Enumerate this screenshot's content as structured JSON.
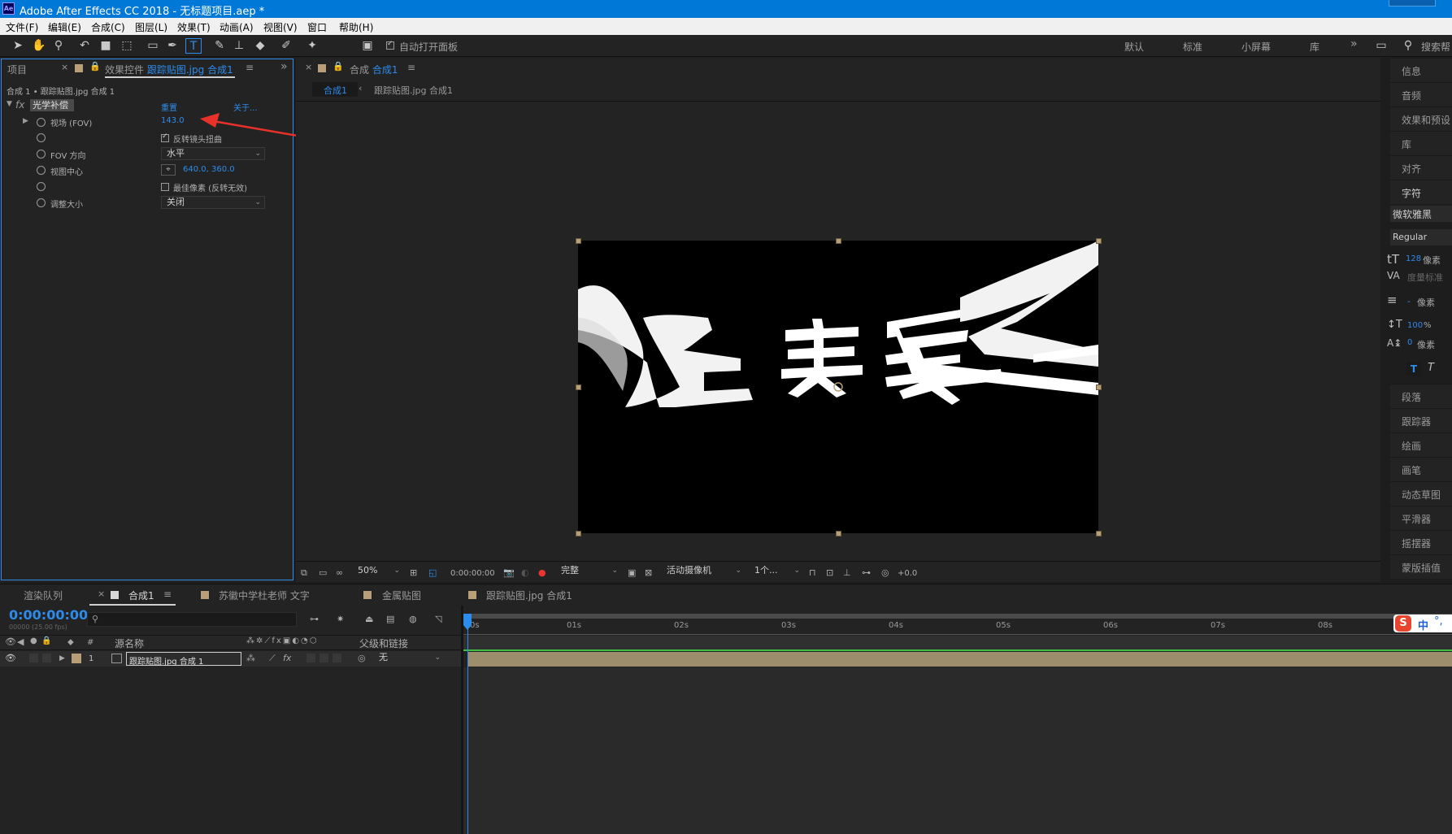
{
  "window": {
    "app_icon": "Ae",
    "title": "Adobe After Effects CC 2018 - 无标题项目.aep *"
  },
  "menu": [
    "文件(F)",
    "编辑(E)",
    "合成(C)",
    "图层(L)",
    "效果(T)",
    "动画(A)",
    "视图(V)",
    "窗口",
    "帮助(H)"
  ],
  "toolbar": {
    "auto_open_label": "自动打开面板",
    "workspaces": [
      "默认",
      "标准",
      "小屏幕",
      "库"
    ],
    "overflow": "»",
    "search_label": "搜索帮"
  },
  "left_panel": {
    "tab_project": "项目",
    "tab_effect_prefix": "效果控件",
    "tab_effect_layer": "跟踪贴图.jpg",
    "tab_effect_comp": "合成1",
    "breadcrumb": "合成 1 • 跟踪贴图.jpg 合成 1",
    "effect_name": "光学补偿",
    "reset_label": "重置",
    "about_label": "关于...",
    "fov_label": "视场 (FOV)",
    "fov_value": "143.0",
    "reverse_label": "反转镜头扭曲",
    "fov_dir_label": "FOV 方向",
    "fov_dir_value": "水平",
    "center_label": "视图中心",
    "center_value": "640.0, 360.0",
    "best_pixels_label": "最佳像素 (反转无效)",
    "resize_label": "调整大小",
    "resize_value": "关闭"
  },
  "comp_panel": {
    "tab_prefix": "合成",
    "tab_name": "合成1",
    "crumb_active": "合成1",
    "crumb_next": "跟踪贴图.jpg 合成1",
    "viewer_text": "某某老",
    "zoom": "50%",
    "timecode": "0:00:00:00",
    "resolution": "完整",
    "camera": "活动摄像机",
    "views": "1个...",
    "exposure": "+0.0"
  },
  "right_panel": {
    "items": [
      "信息",
      "音频",
      "效果和预设",
      "库",
      "对齐",
      "字符"
    ],
    "font": "微软雅黑",
    "style": "Regular",
    "font_size": "128",
    "px": "像素",
    "tracking_label": "度量标准",
    "leading_dash": "-",
    "vscale": "100",
    "pct": "%",
    "baseline": "0",
    "bottom_items": [
      "段落",
      "跟踪器",
      "绘画",
      "画笔",
      "动态草图",
      "平滑器",
      "摇摆器",
      "蒙版插值"
    ]
  },
  "timeline": {
    "tabs": [
      "渲染队列",
      "合成1",
      "苏徽中学杜老师 文字",
      "金属贴图",
      "跟踪贴图.jpg 合成1"
    ],
    "timecode": "0:00:00:00",
    "fps_info": "00000 (25.00 fps)",
    "col_num": "#",
    "col_source": "源名称",
    "col_parent": "父级和链接",
    "layer_num": "1",
    "layer_name": "跟踪贴图.jpg 合成 1",
    "parent_value": "无",
    "ticks": [
      "0s",
      "01s",
      "02s",
      "03s",
      "04s",
      "05s",
      "06s",
      "07s",
      "08s"
    ],
    "ime_text": "中"
  },
  "colors": {
    "accent": "#2d8ceb",
    "titlebar": "#0078d7",
    "annotation": "#e8312a",
    "layer_bar": "#9c8d6d"
  }
}
